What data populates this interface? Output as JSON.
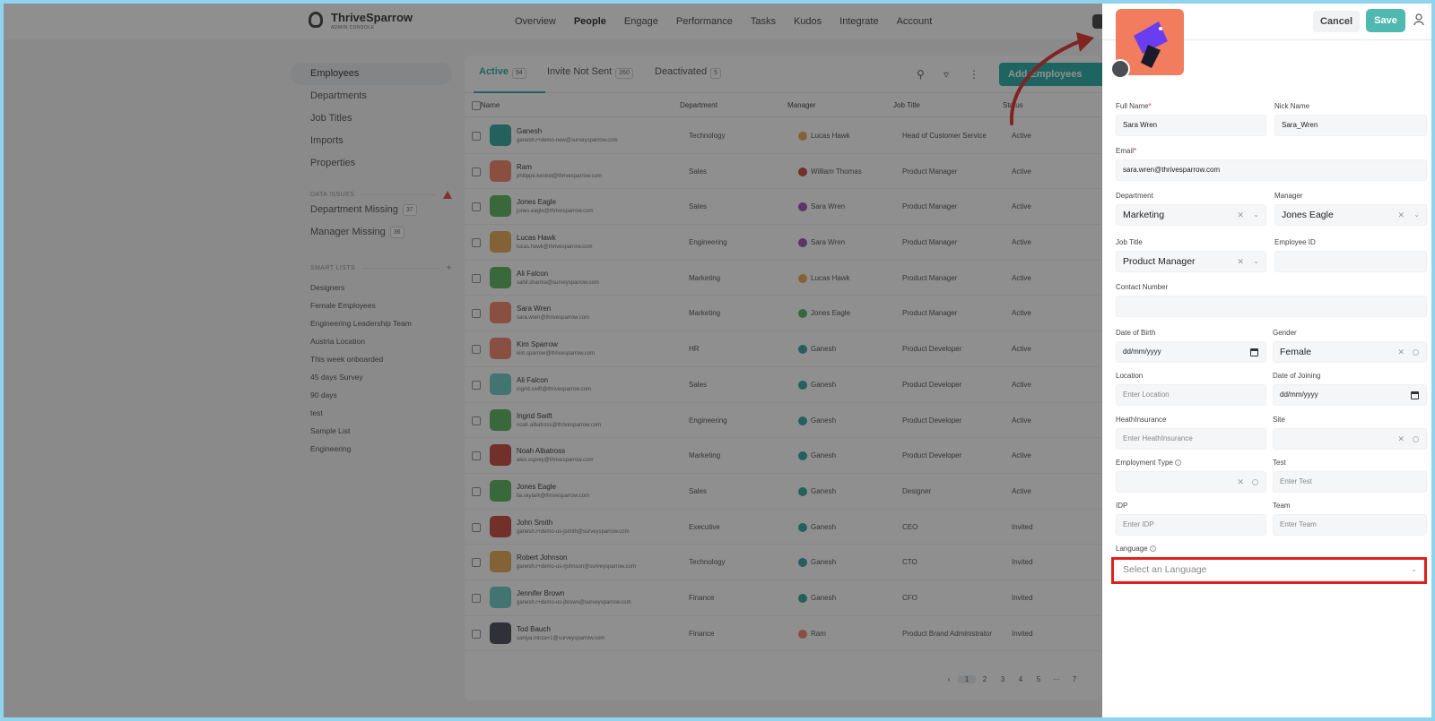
{
  "header": {
    "brand": "ThriveSparrow",
    "brand_sub": "ADMIN CONSOLE",
    "nav": [
      "Overview",
      "People",
      "Engage",
      "Performance",
      "Tasks",
      "Kudos",
      "Integrate",
      "Account"
    ],
    "nav_active": "People"
  },
  "sidebar": {
    "items": [
      "Employees",
      "Departments",
      "Job Titles",
      "Imports",
      "Properties"
    ],
    "data_issues_label": "DATA ISSUES",
    "issues": [
      {
        "label": "Department Missing",
        "count": "37"
      },
      {
        "label": "Manager Missing",
        "count": "36"
      }
    ],
    "smart_lists_label": "SMART LISTS",
    "smart_lists": [
      "Designers",
      "Female Employees",
      "Engineering Leadership Team",
      "Austria Location",
      "This week onboarded",
      "45 days Survey",
      "90 days",
      "test",
      "Sample List",
      "Engineering"
    ]
  },
  "tabs": [
    {
      "label": "Active",
      "count": "94"
    },
    {
      "label": "Invite Not Sent",
      "count": "260"
    },
    {
      "label": "Deactivated",
      "count": "5"
    }
  ],
  "add_button": "Add Employees",
  "columns": [
    "Name",
    "Department",
    "Manager",
    "Job Title",
    "Status"
  ],
  "rows": [
    {
      "name": "Ganesh",
      "email": "ganesh.r+demo-new@surveysparrow.com",
      "dept": "Technology",
      "manager": "Lucas Hawk",
      "title": "Head of Customer Service",
      "status": "Active",
      "color": "#1f9e9a",
      "mcolor": "#e7a443"
    },
    {
      "name": "Ram",
      "email": "philippe.kestrel@thrivesparrow.com",
      "dept": "Sales",
      "manager": "William Thomas",
      "title": "Product Manager",
      "status": "Active",
      "color": "#f27c5e",
      "mcolor": "#c0392b"
    },
    {
      "name": "Jones Eagle",
      "email": "jones.eagle@thrivesparrow.com",
      "dept": "Sales",
      "manager": "Sara Wren",
      "title": "Product Manager",
      "status": "Active",
      "color": "#4caf50",
      "mcolor": "#8e44ad"
    },
    {
      "name": "Lucas Hawk",
      "email": "lucas.hawk@thrivesparrow.com",
      "dept": "Engineering",
      "manager": "Sara Wren",
      "title": "Product Manager",
      "status": "Active",
      "color": "#e7a443",
      "mcolor": "#8e44ad"
    },
    {
      "name": "Ali Falcon",
      "email": "sahil.sharma@surveysparrow.com",
      "dept": "Marketing",
      "manager": "Lucas Hawk",
      "title": "Product Manager",
      "status": "Active",
      "color": "#4caf50",
      "mcolor": "#e7a443"
    },
    {
      "name": "Sara Wren",
      "email": "sara.wren@thrivesparrow.com",
      "dept": "Marketing",
      "manager": "Jones Eagle",
      "title": "Product Manager",
      "status": "Active",
      "color": "#f27c5e",
      "mcolor": "#4caf50"
    },
    {
      "name": "Kim Sparrow",
      "email": "kim.sparrow@thrivesparrow.com",
      "dept": "HR",
      "manager": "Ganesh",
      "title": "Product Developer",
      "status": "Active",
      "color": "#f27c5e",
      "mcolor": "#1f9e9a"
    },
    {
      "name": "Ali Falcon",
      "email": "ingrid.swift@thrivesparrow.com",
      "dept": "Sales",
      "manager": "Ganesh",
      "title": "Product Developer",
      "status": "Active",
      "color": "#5fc9c3",
      "mcolor": "#1f9e9a"
    },
    {
      "name": "Ingrid Swift",
      "email": "noah.albatross@thrivesparrow.com",
      "dept": "Engineering",
      "manager": "Ganesh",
      "title": "Product Developer",
      "status": "Active",
      "color": "#4caf50",
      "mcolor": "#1f9e9a"
    },
    {
      "name": "Noah Albatross",
      "email": "alex.osprey@thrivesparrow.com",
      "dept": "Marketing",
      "manager": "Ganesh",
      "title": "Product Developer",
      "status": "Active",
      "color": "#c0392b",
      "mcolor": "#1f9e9a"
    },
    {
      "name": "Jones Eagle",
      "email": "lia.skylark@thrivesparrow.com",
      "dept": "Sales",
      "manager": "Ganesh",
      "title": "Designer",
      "status": "Active",
      "color": "#4caf50",
      "mcolor": "#1f9e9a"
    },
    {
      "name": "John Smith",
      "email": "ganesh.r+demo-us-jsmith@surveysparrow.com",
      "dept": "Executive",
      "manager": "Ganesh",
      "title": "CEO",
      "status": "Invited",
      "color": "#c0392b",
      "mcolor": "#1f9e9a"
    },
    {
      "name": "Robert Johnson",
      "email": "ganesh.r+demo-us-rjohnson@surveysparrow.com",
      "dept": "Technology",
      "manager": "Ganesh",
      "title": "CTO",
      "status": "Invited",
      "color": "#e7a443",
      "mcolor": "#1f9e9a"
    },
    {
      "name": "Jennifer Brown",
      "email": "ganesh.r+demo-us-jbrown@surveysparrow.com",
      "dept": "Finance",
      "manager": "Ganesh",
      "title": "CFO",
      "status": "Invited",
      "color": "#5fc9c3",
      "mcolor": "#1f9e9a"
    },
    {
      "name": "Tod Bauch",
      "email": "saniya.mirza+1@surveysparrow.com",
      "dept": "Finance",
      "manager": "Ram",
      "title": "Product Brand Administrator",
      "status": "Invited",
      "color": "#3a3a4a",
      "mcolor": "#f27c5e"
    }
  ],
  "pager": [
    "1",
    "2",
    "3",
    "4",
    "5",
    "···",
    "7"
  ],
  "panel": {
    "cancel": "Cancel",
    "save": "Save",
    "full_name_label": "Full Name",
    "full_name": "Sara Wren",
    "nick_name_label": "Nick Name",
    "nick_name": "Sara_Wren",
    "email_label": "Email",
    "email": "sara.wren@thrivesparrow.com",
    "department_label": "Department",
    "department": "Marketing",
    "manager_label": "Manager",
    "manager": "Jones Eagle",
    "job_title_label": "Job Title",
    "job_title": "Product Manager",
    "employee_id_label": "Employee ID",
    "contact_label": "Contact Number",
    "dob_label": "Date of Birth",
    "dob_placeholder": "dd/mm/yyyy",
    "gender_label": "Gender",
    "gender": "Female",
    "location_label": "Location",
    "location_placeholder": "Enter Location",
    "doj_label": "Date of Joining",
    "doj_placeholder": "dd/mm/yyyy",
    "health_label": "HeathInsurance",
    "health_placeholder": "Enter HeathInsurance",
    "site_label": "Site",
    "emp_type_label": "Employment Type",
    "test_label": "Test",
    "test_placeholder": "Enter Test",
    "idp_label": "IDP",
    "idp_placeholder": "Enter IDP",
    "team_label": "Team",
    "team_placeholder": "Enter Team",
    "language_label": "Language",
    "language_placeholder": "Select an Language"
  },
  "colors": {
    "accent": "#13a6a0",
    "photo_bg": "#f27c5e",
    "highlight": "#e0201c",
    "arrow": "#e0201c"
  }
}
